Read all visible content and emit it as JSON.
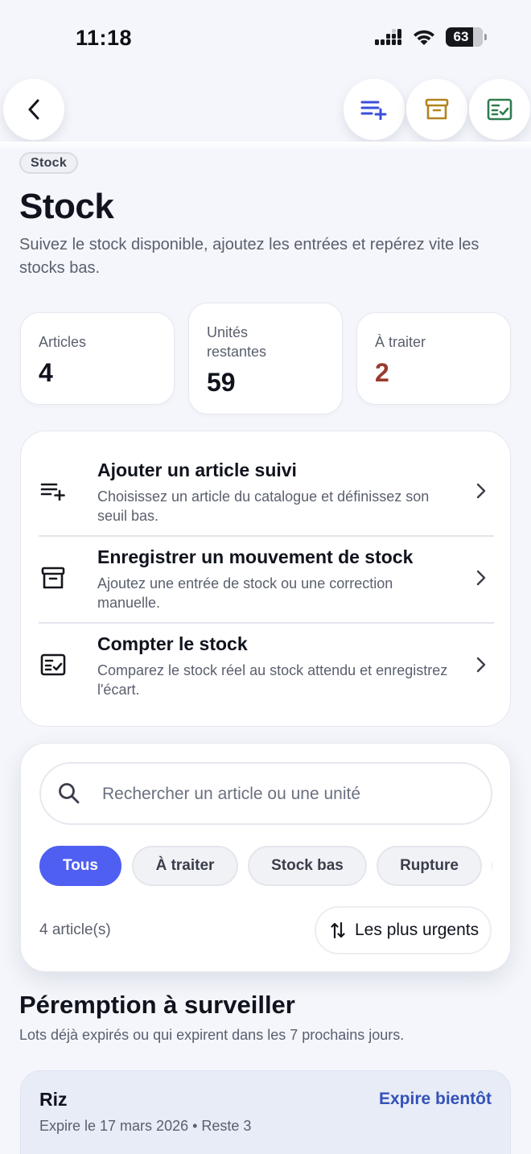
{
  "status_bar": {
    "time": "11:18",
    "battery": "63"
  },
  "nav": {
    "back_icon": "chevron-left-icon",
    "actions": [
      {
        "icon": "playlist-add-icon",
        "color": "#3a4fd8"
      },
      {
        "icon": "archive-box-icon",
        "color": "#b2831f"
      },
      {
        "icon": "checklist-icon",
        "color": "#2e7d4f"
      }
    ]
  },
  "header": {
    "tag": "Stock",
    "title": "Stock",
    "subtitle": "Suivez le stock disponible, ajoutez les entrées et repérez vite les stocks bas."
  },
  "stats": [
    {
      "label": "Articles",
      "value": "4"
    },
    {
      "label": "Unités restantes",
      "value": "59"
    },
    {
      "label": "À traiter",
      "value": "2",
      "color": "#9a3a2e"
    }
  ],
  "actions": [
    {
      "icon": "playlist-add-icon",
      "title": "Ajouter un article suivi",
      "description": "Choisissez un article du catalogue et définissez son seuil bas."
    },
    {
      "icon": "archive-box-icon",
      "title": "Enregistrer un mouvement de stock",
      "description": "Ajoutez une entrée de stock ou une correction manuelle."
    },
    {
      "icon": "checklist-icon",
      "title": "Compter le stock",
      "description": "Comparez le stock réel au stock attendu et enregistrez l'écart."
    }
  ],
  "search": {
    "placeholder": "Rechercher un article ou une unité",
    "value": ""
  },
  "filters": [
    {
      "label": "Tous",
      "active": true
    },
    {
      "label": "À traiter",
      "active": false
    },
    {
      "label": "Stock bas",
      "active": false
    },
    {
      "label": "Rupture",
      "active": false
    },
    {
      "label": "",
      "active": false
    }
  ],
  "results": {
    "count": "4 article(s)",
    "sort_label": "Les plus urgents"
  },
  "expiry": {
    "title": "Péremption à surveiller",
    "subtitle": "Lots déjà expirés ou qui expirent dans les 7 prochains jours.",
    "items": [
      {
        "name": "Riz",
        "status": "Expire bientôt",
        "meta": "Expire le 17 mars 2026 • Reste 3"
      }
    ]
  },
  "colors": {
    "accent": "#4f5ff2",
    "alert": "#9a3a2e",
    "expiry_status": "#3352b8"
  }
}
